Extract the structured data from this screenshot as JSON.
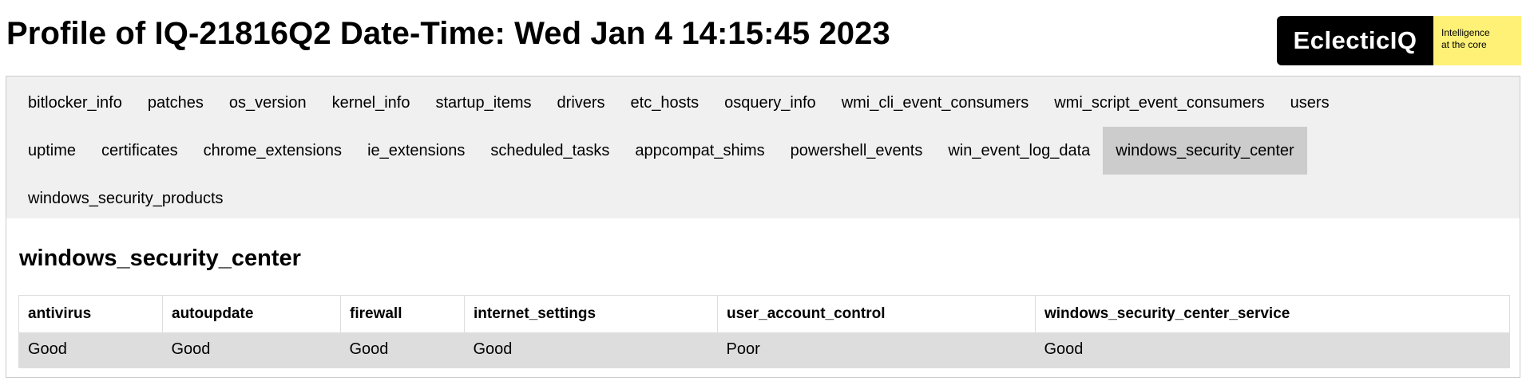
{
  "header": {
    "title": "Profile of IQ-21816Q2 Date-Time: Wed Jan 4 14:15:45 2023"
  },
  "logo": {
    "brand": "EclecticIQ",
    "tagline_line1": "Intelligence",
    "tagline_line2": "at the core",
    "colors": {
      "mark": "#000000",
      "tagline_bg": "#fff176"
    }
  },
  "tabs": {
    "active": "windows_security_center",
    "rows": [
      [
        "bitlocker_info",
        "patches",
        "os_version",
        "kernel_info",
        "startup_items",
        "drivers",
        "etc_hosts",
        "osquery_info",
        "wmi_cli_event_consumers",
        "wmi_script_event_consumers",
        "users"
      ],
      [
        "uptime",
        "certificates",
        "chrome_extensions",
        "ie_extensions",
        "scheduled_tasks",
        "appcompat_shims",
        "powershell_events",
        "win_event_log_data",
        "windows_security_center"
      ],
      [
        "windows_security_products"
      ]
    ]
  },
  "section": {
    "title": "windows_security_center",
    "table": {
      "columns": [
        "antivirus",
        "autoupdate",
        "firewall",
        "internet_settings",
        "user_account_control",
        "windows_security_center_service"
      ],
      "rows": [
        [
          "Good",
          "Good",
          "Good",
          "Good",
          "Poor",
          "Good"
        ]
      ]
    }
  }
}
